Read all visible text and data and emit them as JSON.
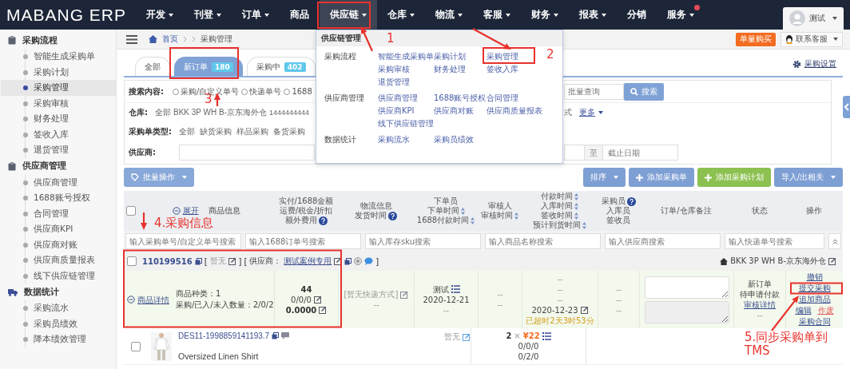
{
  "logo": "MABANG ERP",
  "nav": [
    {
      "label": "开发",
      "has_menu": true,
      "selected": false,
      "notification": false
    },
    {
      "label": "刊登",
      "has_menu": true,
      "selected": false,
      "notification": false
    },
    {
      "label": "订单",
      "has_menu": true,
      "selected": false,
      "notification": false
    },
    {
      "label": "商品",
      "has_menu": false,
      "selected": false,
      "notification": false
    },
    {
      "label": "供应链",
      "has_menu": true,
      "selected": true,
      "notification": false
    },
    {
      "label": "仓库",
      "has_menu": true,
      "selected": false,
      "notification": false
    },
    {
      "label": "物流",
      "has_menu": true,
      "selected": false,
      "notification": false
    },
    {
      "label": "客服",
      "has_menu": true,
      "selected": false,
      "notification": false
    },
    {
      "label": "财务",
      "has_menu": true,
      "selected": false,
      "notification": false
    },
    {
      "label": "报表",
      "has_menu": true,
      "selected": false,
      "notification": false
    },
    {
      "label": "分销",
      "has_menu": false,
      "selected": false,
      "notification": false
    },
    {
      "label": "服务",
      "has_menu": true,
      "selected": false,
      "notification": true
    }
  ],
  "user": {
    "name": "测试"
  },
  "sidebar": [
    {
      "title": "采购流程",
      "items": [
        {
          "label": "智能生成采购单",
          "selected": false
        },
        {
          "label": "采购计划",
          "selected": false
        },
        {
          "label": "采购管理",
          "selected": true
        },
        {
          "label": "采购审核",
          "selected": false
        },
        {
          "label": "财务处理",
          "selected": false
        },
        {
          "label": "签收入库",
          "selected": false
        },
        {
          "label": "退货管理",
          "selected": false
        }
      ]
    },
    {
      "title": "供应商管理",
      "items": [
        {
          "label": "供应商管理",
          "selected": false
        },
        {
          "label": "1688账号授权",
          "selected": false
        },
        {
          "label": "合同管理",
          "selected": false
        },
        {
          "label": "供应商KPI",
          "selected": false
        },
        {
          "label": "供应商对账",
          "selected": false
        },
        {
          "label": "供应商质量报表",
          "selected": false
        },
        {
          "label": "线下供应链管理",
          "selected": false
        }
      ]
    },
    {
      "title": "数据统计",
      "items": [
        {
          "label": "采购流水",
          "selected": false
        },
        {
          "label": "采购员绩效",
          "selected": false
        },
        {
          "label": "降本绩效管理",
          "selected": false
        }
      ]
    }
  ],
  "breadcrumb": {
    "home": "首页",
    "current": "采购管理"
  },
  "top_actions": {
    "buy": "单量购买",
    "support": "联系客服"
  },
  "tabs": [
    {
      "label": "全部",
      "selected": false
    },
    {
      "label": "新订单",
      "count": "180",
      "selected": true
    },
    {
      "label": "采购中",
      "count": "402",
      "selected": false
    }
  ],
  "settings_link": "采购设置",
  "filters": {
    "search": {
      "label": "搜索内容:",
      "options": [
        {
          "label": "采购/自定义单号",
          "selected": false
        },
        {
          "label": "快递单号",
          "selected": false
        },
        {
          "label": "1688",
          "selected": false
        }
      ],
      "placeholder": "批量查询",
      "button": "搜索"
    },
    "warehouse": {
      "label": "仓库:",
      "options": [
        "全部",
        "BKK 3P WH B-京东海外仓",
        "1444444444"
      ],
      "trailing": "式",
      "more": "更多"
    },
    "type": {
      "label": "采购单类型:",
      "options": [
        "全部",
        "缺货采购",
        "样品采购",
        "备货采购"
      ]
    },
    "supplier": {
      "label": "供应商:",
      "range_separator": "至",
      "end_placeholder": "截止日期"
    }
  },
  "toolbar": {
    "batch": "批量操作",
    "buttons": [
      {
        "label": "排序",
        "kind": "menu",
        "color": "#7e9fd3"
      },
      {
        "label": "添加采购单",
        "kind": "add",
        "color": "#7e9fd3"
      },
      {
        "label": "添加采购计划",
        "kind": "add",
        "color": "#8cc152"
      },
      {
        "label": "导入/出相关",
        "kind": "menu",
        "color": "#7e9fd3"
      }
    ]
  },
  "table": {
    "all_checked": false,
    "expand_link": "展开",
    "product_header": "商品信息",
    "columns": [
      {
        "lines": [
          {
            "text": "实付/1688金额",
            "sort": false,
            "help": false
          },
          {
            "text": "运费/税金/折扣",
            "sort": false,
            "help": false
          },
          {
            "text": "额外费用",
            "sort": false,
            "help": true
          }
        ]
      },
      {
        "lines": [
          {
            "text": "物流信息",
            "sort": false,
            "help": false
          },
          {
            "text": "发货时间",
            "sort": false,
            "help": true
          }
        ]
      },
      {
        "lines": [
          {
            "text": "下单员",
            "sort": false,
            "help": false
          },
          {
            "text": "下单时间",
            "sort": true,
            "help": false
          },
          {
            "text": "1688付款时间",
            "sort": true,
            "help": false
          }
        ]
      },
      {
        "lines": [
          {
            "text": "审核人",
            "sort": false,
            "help": false
          },
          {
            "text": "审核时间",
            "sort": true,
            "help": false
          }
        ]
      },
      {
        "lines": [
          {
            "text": "付款时间",
            "sort": true,
            "help": false
          },
          {
            "text": "入库时间",
            "sort": true,
            "help": false
          },
          {
            "text": "签收时间",
            "sort": true,
            "help": false
          },
          {
            "text": "预计到货时间",
            "sort": true,
            "help": false
          }
        ]
      },
      {
        "lines": [
          {
            "text": "采购员",
            "sort": false,
            "help": true
          },
          {
            "text": "入库员",
            "sort": false,
            "help": false
          },
          {
            "text": "签收员",
            "sort": false,
            "help": false
          }
        ]
      },
      {
        "lines": [
          {
            "text": "订单/仓库备注",
            "sort": false,
            "help": false
          }
        ]
      },
      {
        "lines": [
          {
            "text": "状态",
            "sort": false,
            "help": false
          }
        ]
      },
      {
        "lines": [
          {
            "text": "操作",
            "sort": false,
            "help": false
          }
        ]
      }
    ],
    "search_placeholders": [
      "输入采购单号/自定义单号搜索",
      "输入1688订单号搜索",
      "输入库存sku搜索",
      "输入商品名称搜索",
      "输入供应商搜索",
      "输入快递单号搜索"
    ]
  },
  "order": {
    "checked": false,
    "number": "110199516",
    "tag": {
      "open": "[",
      "text": "暂无",
      "close": "]"
    },
    "supplier": {
      "open": "[",
      "label": "供应商：",
      "name": "测试案例专用",
      "close": "]"
    },
    "warehouse": "BKK 3P WH B-京东海外仓",
    "detail_link": "商品详情",
    "sku_types": "商品种类：1",
    "quantities": "采购/已入/未入数量：2/0/2",
    "amounts": [
      "44",
      "0/0/0",
      "0.0000"
    ],
    "logistics": [
      "[暂无快递方式]",
      "--"
    ],
    "creator": [
      "测试",
      "2020-12-21",
      "--"
    ],
    "reviewer": [
      "--",
      "--"
    ],
    "times": [
      "--",
      "--",
      "--",
      "2020-12-23"
    ],
    "overdue": "已超时2天3时53分",
    "staff": [
      "--",
      "--",
      "--"
    ],
    "status": [
      "新订单",
      "待申请付款"
    ],
    "status_link": "审核详情",
    "status_extra": "--",
    "actions": [
      {
        "label": "撤销",
        "kind": "link"
      },
      {
        "label": "提交采购",
        "kind": "link"
      },
      {
        "label": "追加商品",
        "kind": "link"
      },
      {
        "label": "编辑",
        "kind": "link"
      },
      {
        "label": "作废",
        "kind": "danger"
      },
      {
        "label": "采购合同",
        "kind": "link"
      }
    ]
  },
  "item": {
    "checked": false,
    "sku": "DES11-1998859141193.7",
    "name": "Oversized Linen Shirt",
    "note": "暂无",
    "qty": "2",
    "times_sign": "×",
    "price": "¥22",
    "counts": [
      "0/0/0",
      "0/2/0"
    ]
  },
  "dropdown": {
    "title": "供应链管理",
    "sections": [
      {
        "title": "采购流程",
        "links": [
          "智能生成采购单",
          "采购计划",
          "采购管理",
          "采购审核",
          "财务处理",
          "签收入库",
          "退货管理"
        ]
      },
      {
        "title": "供应商管理",
        "links": [
          "供应商管理",
          "1688账号授权",
          "合同管理",
          "供应商KPI",
          "供应商对账",
          "供应商质量报表",
          "线下供应链管理"
        ]
      },
      {
        "title": "数据统计",
        "links": [
          "采购流水",
          "采购员绩效"
        ]
      }
    ]
  },
  "annotations": [
    {
      "label": "1"
    },
    {
      "label": "2"
    },
    {
      "label": "3"
    },
    {
      "label": "4.采购信息"
    },
    {
      "label": "5.同步采购单到TMS"
    }
  ]
}
